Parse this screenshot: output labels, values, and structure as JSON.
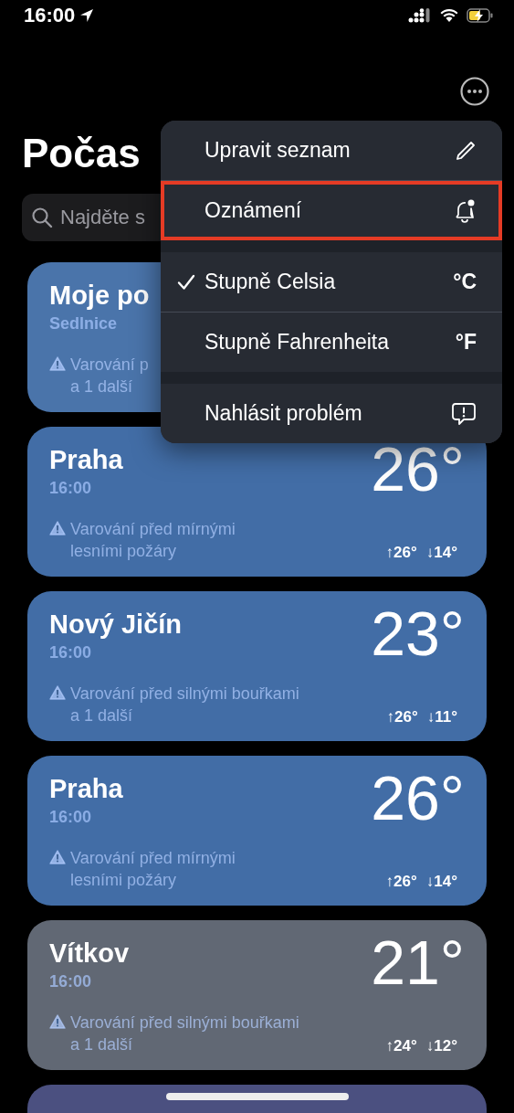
{
  "status_bar": {
    "time": "16:00"
  },
  "title": "Počas",
  "search": {
    "placeholder": "Najděte s"
  },
  "cards": [
    {
      "name": "Moje po",
      "subtitle": "Sedlnice",
      "warning_lines": [
        "Varování p",
        "a 1 další"
      ],
      "color": "#4a74aa"
    },
    {
      "name": "Praha",
      "subtitle": "16:00",
      "temp": "26°",
      "warning_lines": [
        "Varování před mírnými",
        "lesními požáry"
      ],
      "high": "↑26°",
      "low": "↓14°",
      "color": "#426da6"
    },
    {
      "name": "Nový Jičín",
      "subtitle": "16:00",
      "temp": "23°",
      "warning_lines": [
        "Varování před silnými bouřkami",
        "a 1 další"
      ],
      "high": "↑26°",
      "low": "↓11°",
      "color": "#426da6"
    },
    {
      "name": "Praha",
      "subtitle": "16:00",
      "temp": "26°",
      "warning_lines": [
        "Varování před mírnými",
        "lesními požáry"
      ],
      "high": "↑26°",
      "low": "↓14°",
      "color": "#426da6"
    },
    {
      "name": "Vítkov",
      "subtitle": "16:00",
      "temp": "21°",
      "warning_lines": [
        "Varování před silnými bouřkami",
        "a 1 další"
      ],
      "high": "↑24°",
      "low": "↓12°",
      "color": "#616874"
    },
    {
      "color": "#4b5080"
    }
  ],
  "menu": {
    "groups": [
      [
        {
          "label": "Upravit seznam",
          "kind": "edit",
          "checked": false,
          "highlighted": false
        },
        {
          "label": "Oznámení",
          "kind": "notify",
          "checked": false,
          "highlighted": true
        }
      ],
      [
        {
          "label": "Stupně Celsia",
          "symbol": "°C",
          "checked": true,
          "highlighted": false
        },
        {
          "label": "Stupně Fahrenheita",
          "symbol": "°F",
          "checked": false,
          "highlighted": false
        }
      ],
      [
        {
          "label": "Nahlásit problém",
          "kind": "report",
          "checked": false,
          "highlighted": false
        }
      ]
    ]
  }
}
